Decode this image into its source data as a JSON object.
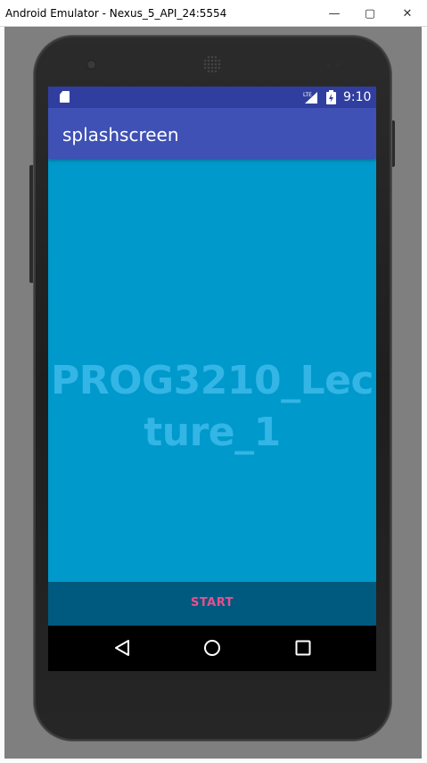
{
  "window": {
    "title": "Android Emulator - Nexus_5_API_24:5554",
    "controls": {
      "minimize": "—",
      "maximize": "▢",
      "close": "✕"
    }
  },
  "status_bar": {
    "network": "LTE",
    "time": "9:10"
  },
  "app_bar": {
    "title": "splashscreen"
  },
  "content": {
    "splash_text": "PROG3210_Lecture_1"
  },
  "bottom_bar": {
    "start_label": "START"
  },
  "colors": {
    "status_bar": "#303f9f",
    "app_bar": "#3f51b5",
    "content_bg": "#0099cc",
    "splash_text": "#33b5e5",
    "bottom_bar": "#005a80",
    "start_text": "#e8508e"
  },
  "icons": {
    "sd_card": "sd-card-icon",
    "signal": "lte-signal-icon",
    "battery": "battery-charging-icon",
    "back": "back-triangle-icon",
    "home": "home-circle-icon",
    "recents": "recents-square-icon"
  }
}
